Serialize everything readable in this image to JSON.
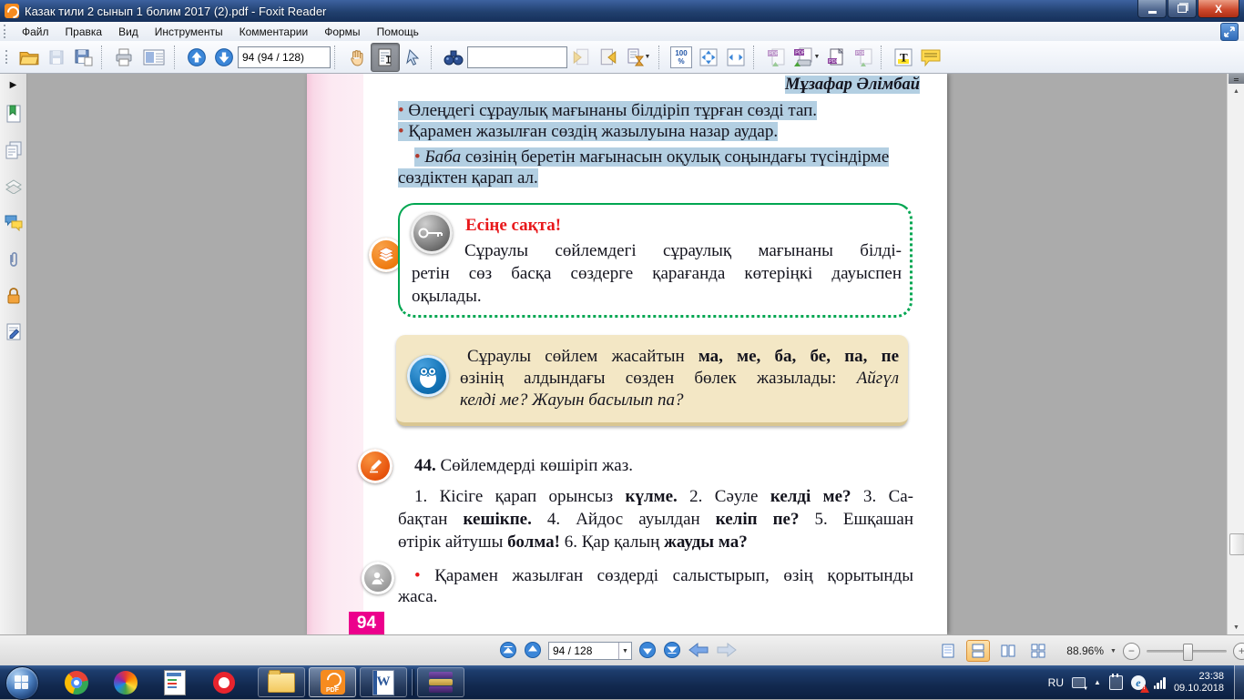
{
  "window": {
    "title": "Казак тили 2 сынып 1 болим 2017 (2).pdf - Foxit Reader"
  },
  "menu": {
    "items": [
      "Файл",
      "Правка",
      "Вид",
      "Инструменты",
      "Комментарии",
      "Формы",
      "Помощь"
    ]
  },
  "toolbar": {
    "page_field_value": "94 (94 / 128)",
    "search_value": "",
    "zoom_100_label": "100 %"
  },
  "statusbar": {
    "page_combo": "94 / 128",
    "zoom_value": "88.96%"
  },
  "taskbar": {
    "tray": {
      "language": "RU",
      "time": "23:38",
      "date": "09.10.2018"
    }
  },
  "colors": {
    "selection": "#b3cfe2",
    "box_green": "#00a651",
    "box_tan": "#f3e7c5",
    "page_badge_magenta": "#ec008c",
    "heading_red": "#e8191c",
    "foxit_orange": "#f68b1f"
  },
  "doc": {
    "author": "Мұзафар Әлімбай",
    "intro": {
      "lines": [
        [
          {
            "t": "• ",
            "c": "#b03a2e"
          },
          {
            "t": "Өлеңдегі сұраулық мағынаны білдіріп тұрған сөзді тап."
          }
        ],
        [
          {
            "t": "• ",
            "c": "#b03a2e"
          },
          {
            "t": "Қарамен жазылған сөздің жазылуына назар аудар."
          }
        ],
        [
          {
            "t": "• ",
            "c": "#b03a2e"
          },
          {
            "t": "Баба",
            "i": true
          },
          {
            "t": " сөзінің беретін мағынасын оқулық соңындағы түсіндірме"
          }
        ],
        [
          {
            "t": "сөздіктен қарап ал."
          }
        ]
      ]
    },
    "remember": {
      "title": "Есіңе сақта!",
      "lines": [
        "Сұраулы сөйлемдегі сұраулық мағынаны білді-",
        "ретін сөз басқа сөздерге қарағанда көтеріңкі дауыспен",
        "оқылады."
      ]
    },
    "rule": {
      "lines": [
        [
          {
            "t": "Сұраулы сөйлем жасайтын "
          },
          {
            "t": "ма, ме, ба, бе, па, пе",
            "b": true
          }
        ],
        [
          {
            "t": "өзінің алдындағы сөзден бөлек жазылады: "
          },
          {
            "t": "Айгүл",
            "i": true
          }
        ],
        [
          {
            "t": "келді ме? Жауын басылып па?",
            "i": true
          }
        ]
      ]
    },
    "exercise": {
      "heading": [
        {
          "t": "44.",
          "b": true
        },
        {
          "t": " Сөйлемдерді көшіріп жаз."
        }
      ],
      "lines": [
        [
          {
            "t": "1. Кісіге қарап орынсыз "
          },
          {
            "t": "күлме.",
            "b": true
          },
          {
            "t": " 2. Сәуле "
          },
          {
            "t": "келді ме?",
            "b": true
          },
          {
            "t": " 3. Са-"
          }
        ],
        [
          {
            "t": "бақтан "
          },
          {
            "t": "кешікпе.",
            "b": true
          },
          {
            "t": " 4. Айдос ауылдан "
          },
          {
            "t": "келіп пе?",
            "b": true
          },
          {
            "t": " 5. Ешқашан"
          }
        ],
        [
          {
            "t": "өтірік айтушы "
          },
          {
            "t": "болма!",
            "b": true
          },
          {
            "t": " 6. Қар қалың "
          },
          {
            "t": "жауды ма?",
            "b": true
          }
        ]
      ]
    },
    "task": {
      "lines": [
        [
          {
            "t": "• ",
            "c": "#e8191c"
          },
          {
            "t": "Қарамен жазылған сөздерді салыстырып, өзің қорытынды"
          }
        ],
        [
          {
            "t": "жаса."
          }
        ]
      ]
    },
    "page_number": "94"
  }
}
